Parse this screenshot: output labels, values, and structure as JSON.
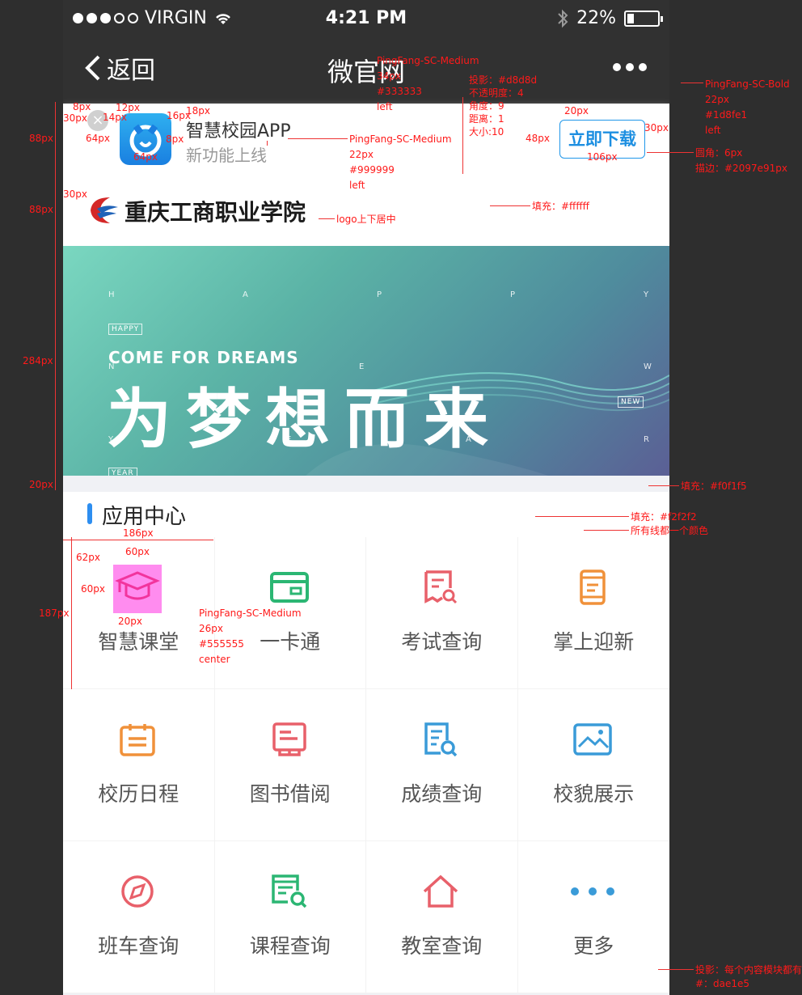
{
  "status_bar": {
    "carrier": "VIRGIN",
    "time": "4:21 PM",
    "battery": "22%",
    "battery_level": 0.22
  },
  "nav": {
    "back_label": "返回",
    "title": "微官网"
  },
  "app_banner": {
    "close": "×",
    "name": "智慧校园APP",
    "subtitle": "新功能上线",
    "download": "立即下载"
  },
  "school": {
    "name": "重庆工商职业学院"
  },
  "hero": {
    "letters": [
      "H",
      "A",
      "P",
      "P",
      "Y",
      "N",
      "E",
      "W",
      "Y",
      "E",
      "A",
      "R"
    ],
    "tag1": "HAPPY",
    "tag2": "NEW",
    "tag3": "YEAR",
    "en": "COME FOR DREAMS",
    "cn": "为梦想而来"
  },
  "app_center": {
    "title": "应用中心",
    "items": [
      {
        "label": "智慧课堂",
        "icon": "graduation-cap-icon",
        "color": "#e8606a"
      },
      {
        "label": "一卡通",
        "icon": "card-icon",
        "color": "#2bb673"
      },
      {
        "label": "考试查询",
        "icon": "exam-search-icon",
        "color": "#e8606a"
      },
      {
        "label": "掌上迎新",
        "icon": "phone-icon",
        "color": "#f0913a"
      },
      {
        "label": "校历日程",
        "icon": "calendar-icon",
        "color": "#f0913a"
      },
      {
        "label": "图书借阅",
        "icon": "book-icon",
        "color": "#e8606a"
      },
      {
        "label": "成绩查询",
        "icon": "score-search-icon",
        "color": "#3a9bd8"
      },
      {
        "label": "校貌展示",
        "icon": "image-icon",
        "color": "#3a9bd8"
      },
      {
        "label": "班车查询",
        "icon": "compass-icon",
        "color": "#e8606a"
      },
      {
        "label": "课程查询",
        "icon": "schedule-search-icon",
        "color": "#2bb673"
      },
      {
        "label": "教室查询",
        "icon": "home-icon",
        "color": "#e8606a"
      },
      {
        "label": "更多",
        "icon": "more-dots-icon",
        "color": "#3a9bd8"
      }
    ]
  },
  "annotations": {
    "nav_title_font": "PingFang-SC-Medium",
    "nav_title_size": "34px",
    "nav_title_color": "#333333",
    "nav_title_align": "left",
    "shadow": "投影：#d8d8d",
    "opacity": "不透明度：4",
    "angle": "角度：9",
    "distance": "距离：1",
    "size": "大小:10",
    "btn_font": "PingFang-SC-Bold",
    "btn_size": "22px",
    "btn_color": "#1d8fe1",
    "btn_align": "left",
    "sub_font": "PingFang-SC-Medium",
    "sub_size": "22px",
    "sub_color": "#999999",
    "sub_align": "left",
    "radius": "圆角：6px",
    "stroke": "描边：#2097e91px",
    "fill_white": "填充：#ffffff",
    "logo_center": "logo上下居中",
    "fill_bg": "填充：#f0f1f5",
    "fill_line": "填充：#f2f2f2",
    "lines_same": "所有线都一个颜色",
    "label_font": "PingFang-SC-Medium",
    "label_size": "26px",
    "label_color": "#555555",
    "label_align": "center",
    "shadow_all": "投影：每个内容模块都有",
    "shadow_color": "#：dae1e5",
    "d_88a": "88px",
    "d_88b": "88px",
    "d_284": "284px",
    "d_20a": "20px",
    "d_187": "187px",
    "d_8a": "8px",
    "d_30a": "30px",
    "d_12": "12px",
    "d_14": "14px",
    "d_18": "18px",
    "d_64a": "64px",
    "d_64b": "64px",
    "d_16": "16px",
    "d_8b": "8px",
    "d_30b": "30px",
    "d_20b": "20px",
    "d_48": "48px",
    "d_30c": "30px",
    "d_106": "106px",
    "d_186": "186px",
    "d_62": "62px",
    "d_60a": "60px",
    "d_60b": "60px",
    "d_20c": "20px"
  }
}
